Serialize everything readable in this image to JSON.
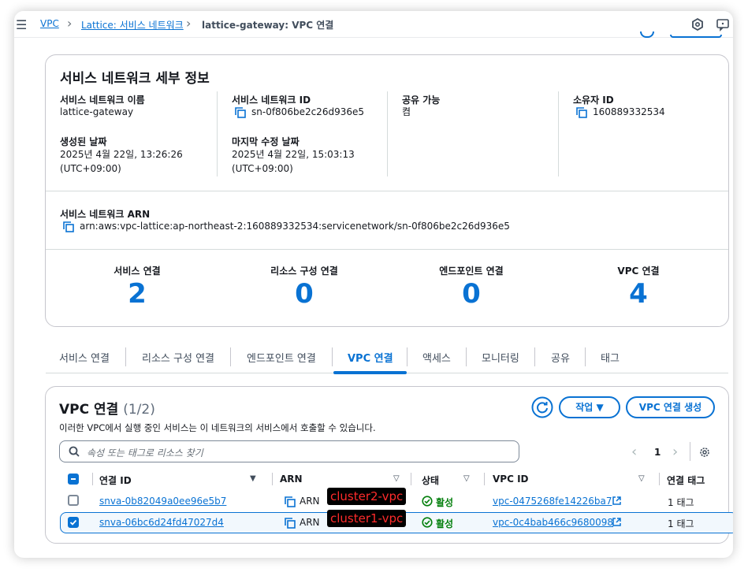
{
  "breadcrumb": {
    "root": "VPC",
    "parent": "Lattice: 서비스 네트워크",
    "current": "lattice-gateway: VPC 연결"
  },
  "details": {
    "title": "서비스 네트워크 세부 정보",
    "name_label": "서비스 네트워크 이름",
    "name_value": "lattice-gateway",
    "id_label": "서비스 네트워크 ID",
    "id_value": "sn-0f806be2c26d936e5",
    "sharable_label": "공유 가능",
    "sharable_value": "켬",
    "owner_label": "소유자 ID",
    "owner_value": "160889332534",
    "created_label": "생성된 날짜",
    "created_value_1": "2025년 4월 22일, 13:26:26",
    "created_value_2": "(UTC+09:00)",
    "modified_label": "마지막 수정 날짜",
    "modified_value_1": "2025년 4월 22일, 15:03:13",
    "modified_value_2": "(UTC+09:00)",
    "arn_label": "서비스 네트워크 ARN",
    "arn_value": "arn:aws:vpc-lattice:ap-northeast-2:160889332534:servicenetwork/sn-0f806be2c26d936e5"
  },
  "counters": [
    {
      "label": "서비스 연결",
      "value": "2"
    },
    {
      "label": "리소스 구성 연결",
      "value": "0"
    },
    {
      "label": "엔드포인트 연결",
      "value": "0"
    },
    {
      "label": "VPC 연결",
      "value": "4"
    }
  ],
  "tabs": [
    "서비스 연결",
    "리소스 구성 연결",
    "엔드포인트 연결",
    "VPC 연결",
    "액세스",
    "모니터링",
    "공유",
    "태그"
  ],
  "active_tab": "VPC 연결",
  "table_section": {
    "title": "VPC 연결",
    "count": "(1/2)",
    "description": "이러한 VPC에서 실행 중인 서비스는 이 네트워크의 서비스에서 호출할 수 있습니다.",
    "actions_label": "작업",
    "create_label": "VPC 연결 생성",
    "search_placeholder": "속성 또는 태그로 리소스 찾기",
    "page": "1",
    "columns": [
      "연결 ID",
      "ARN",
      "상태",
      "VPC ID",
      "연결 태그"
    ],
    "rows": [
      {
        "id": "snva-0b82049a0ee96e5b7",
        "arn": "ARN",
        "annotation": "cluster2-vpc",
        "status": "활성",
        "vpc_id": "vpc-0475268fe14226ba7",
        "tags": "1 태그",
        "selected": false
      },
      {
        "id": "snva-06bc6d24fd47027d4",
        "arn": "ARN",
        "annotation": "cluster1-vpc",
        "status": "활성",
        "vpc_id": "vpc-0c4bab466c9680098",
        "tags": "1 태그",
        "selected": true
      }
    ]
  },
  "colors": {
    "accent": "#0972d3",
    "success": "#037f0c",
    "annotation_text": "#ff2b2b"
  },
  "icons": [
    "menu-icon",
    "chevron-right-icon",
    "settings-shortcut-icon",
    "feedback-icon",
    "copy-icon",
    "refresh-icon",
    "caret-down-icon",
    "search-icon",
    "chevron-left-icon",
    "gear-icon",
    "status-success-icon",
    "external-link-icon"
  ]
}
